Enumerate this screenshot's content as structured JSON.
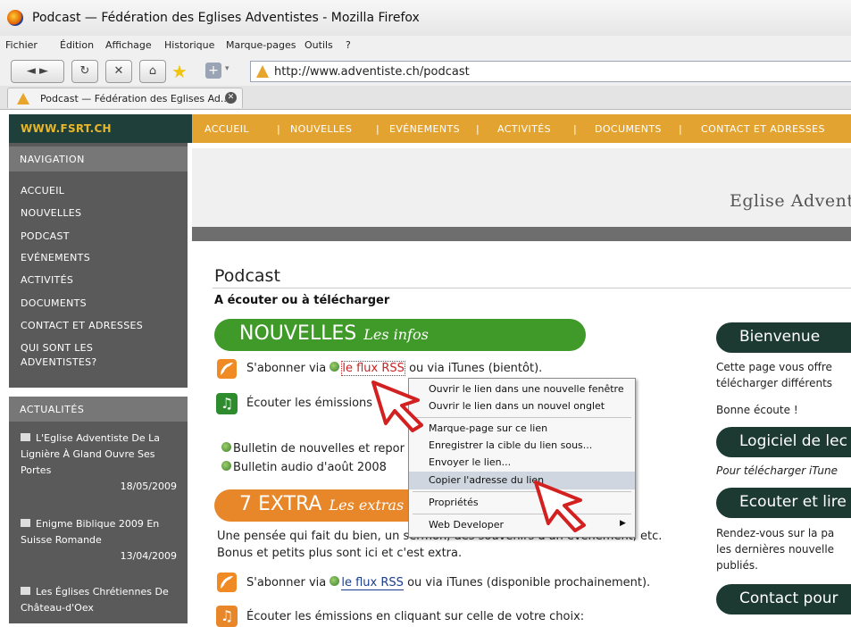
{
  "window": {
    "title": "Podcast — Fédération des Eglises Adventistes - Mozilla Firefox"
  },
  "menubar": [
    "Fichier",
    "Édition",
    "Affichage",
    "Historique",
    "Marque-pages",
    "Outils",
    "?"
  ],
  "toolbar": {
    "url": "http://www.adventiste.ch/podcast"
  },
  "tab": {
    "label": "Podcast — Fédération des Eglises Ad..."
  },
  "site": {
    "logo": "WWW.FSRT.CH",
    "topnav": [
      "ACCUEIL",
      "|",
      "NOUVELLES",
      "|",
      "EVÉNEMENTS",
      "|",
      "ACTIVITÉS",
      "|",
      "DOCUMENTS",
      "|",
      "CONTACT ET ADRESSES"
    ],
    "banner_text": "Eglise Advent"
  },
  "sidebar": {
    "nav_title": "NAVIGATION",
    "items": [
      "ACCUEIL",
      "NOUVELLES",
      "PODCAST",
      "EVÉNEMENTS",
      "ACTIVITÉS",
      "DOCUMENTS",
      "CONTACT ET ADRESSES",
      "QUI SONT LES ADVENTISTES?"
    ],
    "news_title": "ACTUALITÉS",
    "news": [
      {
        "title": "L'Eglise Adventiste De La Lignière À Gland Ouvre Ses Portes",
        "date": "18/05/2009"
      },
      {
        "title": "Enigme Biblique 2009 En Suisse Romande",
        "date": "13/04/2009"
      },
      {
        "title": "Les Églises Chrétiennes De Château-d'Oex",
        "date": ""
      }
    ]
  },
  "main": {
    "title": "Podcast",
    "subtitle": "A écouter ou à télécharger",
    "nouvelles": {
      "big": "NOUVELLES",
      "small": "Les infos"
    },
    "sub_rss_1": {
      "pre": "S'abonner via",
      "link": "le flux RSS",
      "post": "ou via iTunes (bientôt)."
    },
    "listen_1": "Écouter les émissions",
    "bulletin_1": "Bulletin de nouvelles et repor",
    "bulletin_2": "Bulletin audio d'août 2008",
    "extra": {
      "big": "7 EXTRA",
      "small": "Les extras"
    },
    "extra_desc_1": "Une pensée qui fait du bien, un sermon, des souvenirs d'un événement, etc.",
    "extra_desc_2": "Bonus et petits plus sont ici et c'est extra.",
    "sub_rss_2": {
      "pre": "S'abonner via",
      "link": "le flux RSS",
      "post": "ou via iTunes (disponible prochainement)."
    },
    "listen_2": "Écouter les émissions en cliquant sur celle de votre choix:"
  },
  "right": {
    "bienvenue": "Bienvenue",
    "bienvenue_text_1": "Cette page vous offre",
    "bienvenue_text_2": "télécharger différents",
    "bonne": "Bonne écoute !",
    "logiciel": "Logiciel de lec",
    "logiciel_text": "Pour télécharger iTune",
    "ecouter": "Ecouter et lire",
    "ecouter_text_1": "Rendez-vous sur la pa",
    "ecouter_text_2": "les dernières nouvelle",
    "ecouter_text_3": "publiés.",
    "contact": "Contact pour"
  },
  "context_menu": {
    "items": [
      "Ouvrir le lien dans une nouvelle fenêtre",
      "Ouvrir le lien dans un nouvel onglet",
      "Marque-page sur ce lien",
      "Enregistrer la cible du lien sous...",
      "Envoyer le lien...",
      "Copier l'adresse du lien",
      "Propriétés",
      "Web Developer"
    ]
  },
  "colors": {
    "sidebar": "#5a5a5a",
    "topnav": "#e3a330",
    "nouvelles_pill": "#3f9a2a",
    "extra_pill": "#e8872a",
    "right_pill": "#1d3a32"
  }
}
